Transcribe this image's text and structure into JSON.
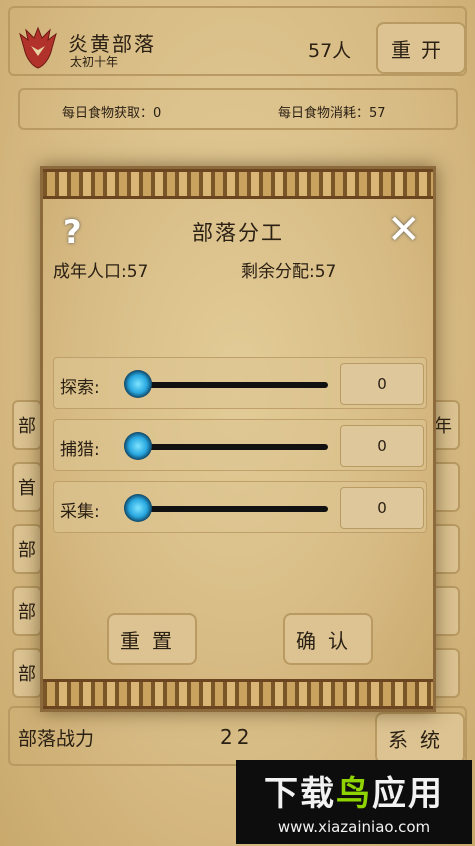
{
  "header": {
    "tribe_name": "炎黄部落",
    "era": "太初十年",
    "population": "57人",
    "restart_label": "重开"
  },
  "food": {
    "income": "每日食物获取：0",
    "consumption": "每日食物消耗：57"
  },
  "side_buttons": {
    "left": [
      "部",
      "首",
      "部",
      "部",
      "部"
    ],
    "right": [
      "年",
      "",
      "",
      "",
      ""
    ]
  },
  "bottom": {
    "power_label": "部落战力",
    "power_value": "22",
    "system_label": "系统"
  },
  "dialog": {
    "title": "部落分工",
    "adult_population": "成年人口:57",
    "remaining": "剩余分配:57",
    "jobs": [
      {
        "label": "探索:",
        "value": "0"
      },
      {
        "label": "捕猎:",
        "value": "0"
      },
      {
        "label": "采集:",
        "value": "0"
      }
    ],
    "reset_label": "重置",
    "confirm_label": "确认"
  },
  "watermark": {
    "main_a": "下载",
    "main_b": "鸟",
    "main_c": "应用",
    "url": "www.xiazainiao.com"
  },
  "colors": {
    "parchment": "#d8bf8a",
    "knob": "#28a7e0",
    "logo": "#b0322a"
  }
}
